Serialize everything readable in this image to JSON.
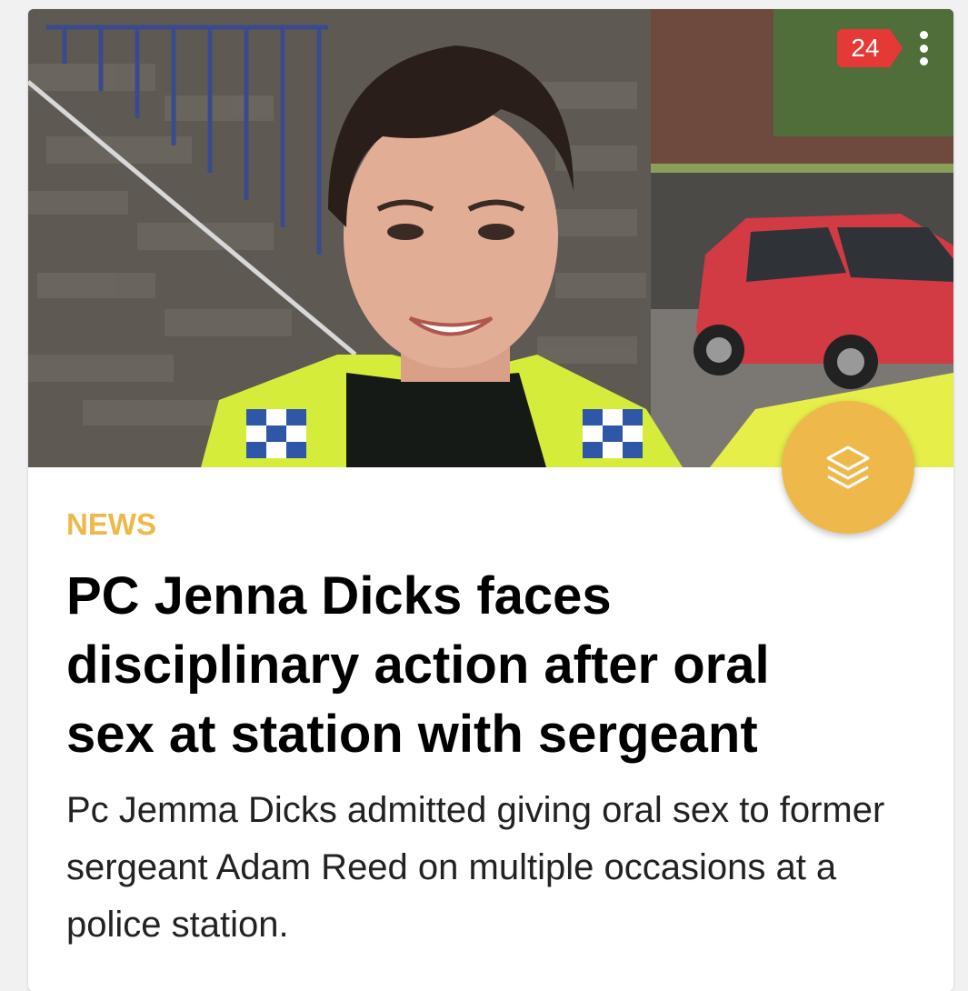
{
  "article": {
    "comment_count": "24",
    "category": "NEWS",
    "headline": "PC Jenna Dicks faces disciplinary action after oral sex at station with sergeant",
    "summary": "Pc Jemma Dicks admitted giving oral sex to former sergeant Adam Reed on multiple occasions at a police station."
  },
  "icons": {
    "more": "more-vertical-icon",
    "fab": "layers-icon"
  },
  "colors": {
    "accent": "#efb84a",
    "badge": "#e53935",
    "headline": "#000000",
    "summary": "#222222"
  }
}
